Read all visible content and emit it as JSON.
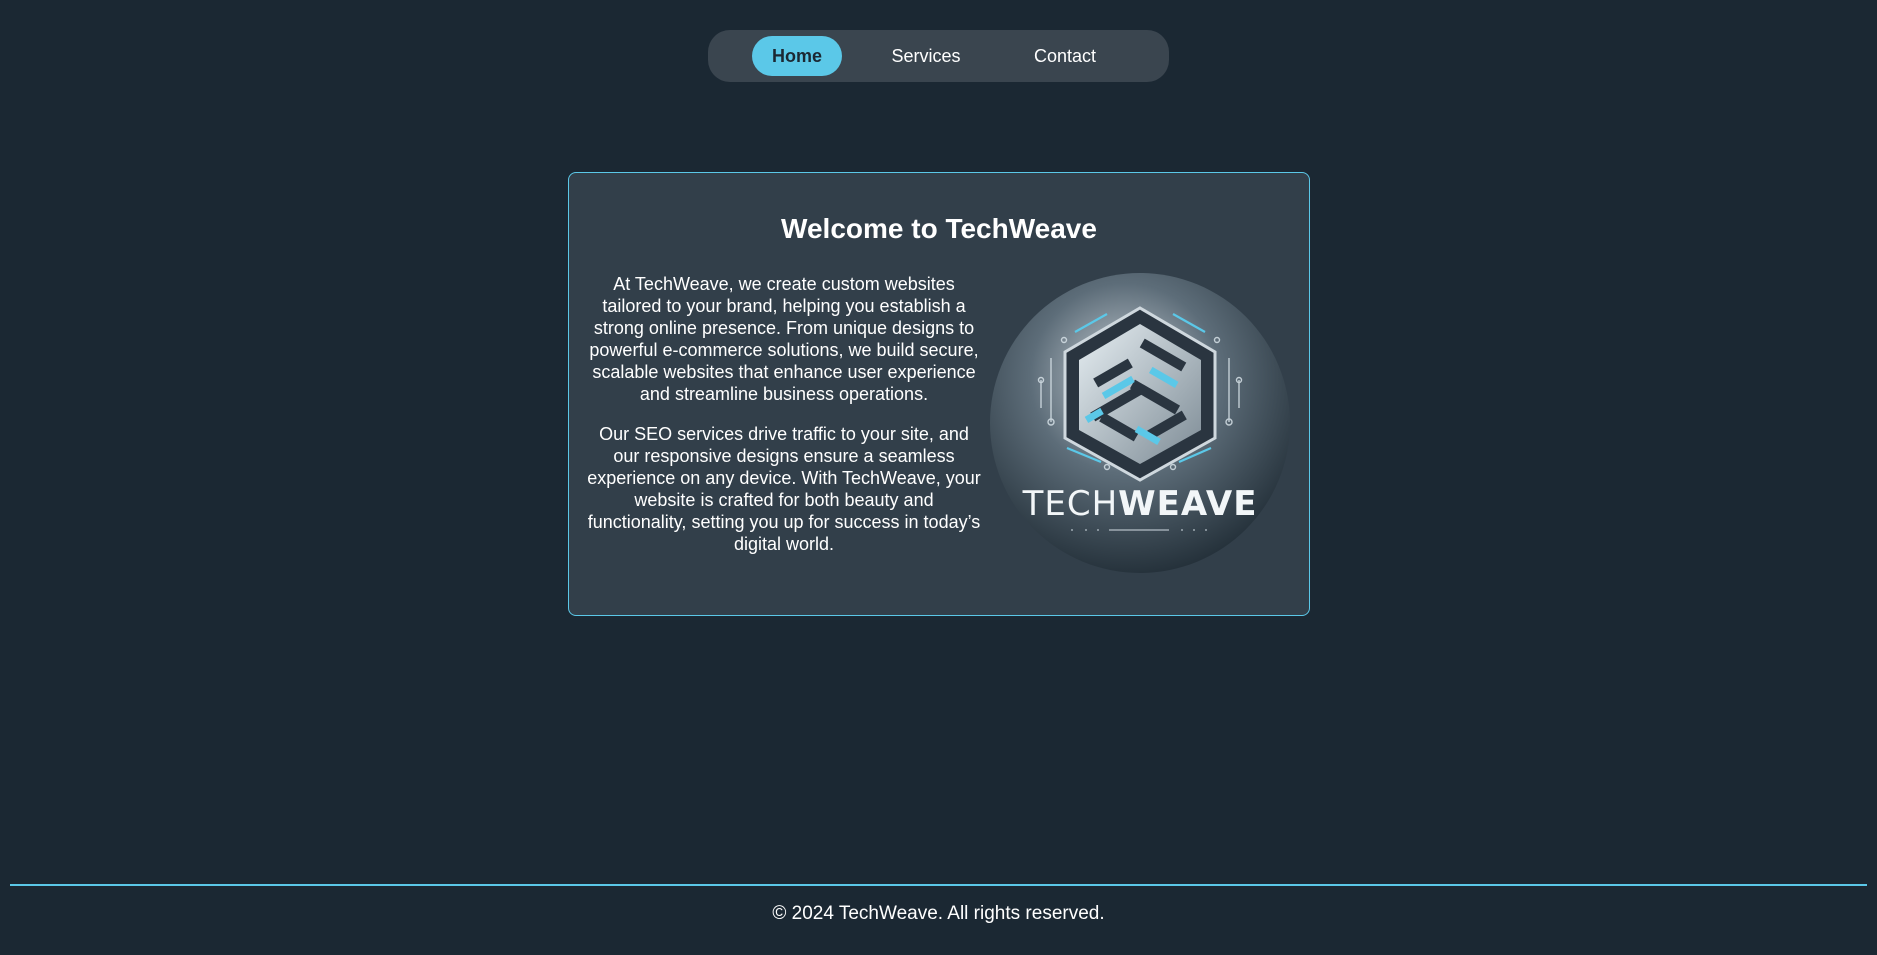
{
  "nav": {
    "items": [
      {
        "label": "Home",
        "active": true
      },
      {
        "label": "Services",
        "active": false
      },
      {
        "label": "Contact",
        "active": false
      }
    ]
  },
  "main": {
    "title": "Welcome to TechWeave",
    "paragraphs": [
      "At TechWeave, we create custom websites tailored to your brand, helping you establish a strong online presence. From unique designs to powerful e-commerce solutions, we build secure, scalable websites that enhance user experience and streamline business operations.",
      "Our SEO services drive traffic to your site, and our responsive designs ensure a seamless experience on any device. With TechWeave, your website is crafted for both beauty and functionality, setting you up for success in today’s digital world."
    ],
    "logo": {
      "brand_light": "TECH",
      "brand_bold": "WEAVE"
    }
  },
  "footer": {
    "text": "© 2024 TechWeave. All rights reserved."
  },
  "colors": {
    "background": "#1b2833",
    "card": "#323f4a",
    "accent": "#5bc8e8",
    "nav_bg": "#3a454f"
  }
}
